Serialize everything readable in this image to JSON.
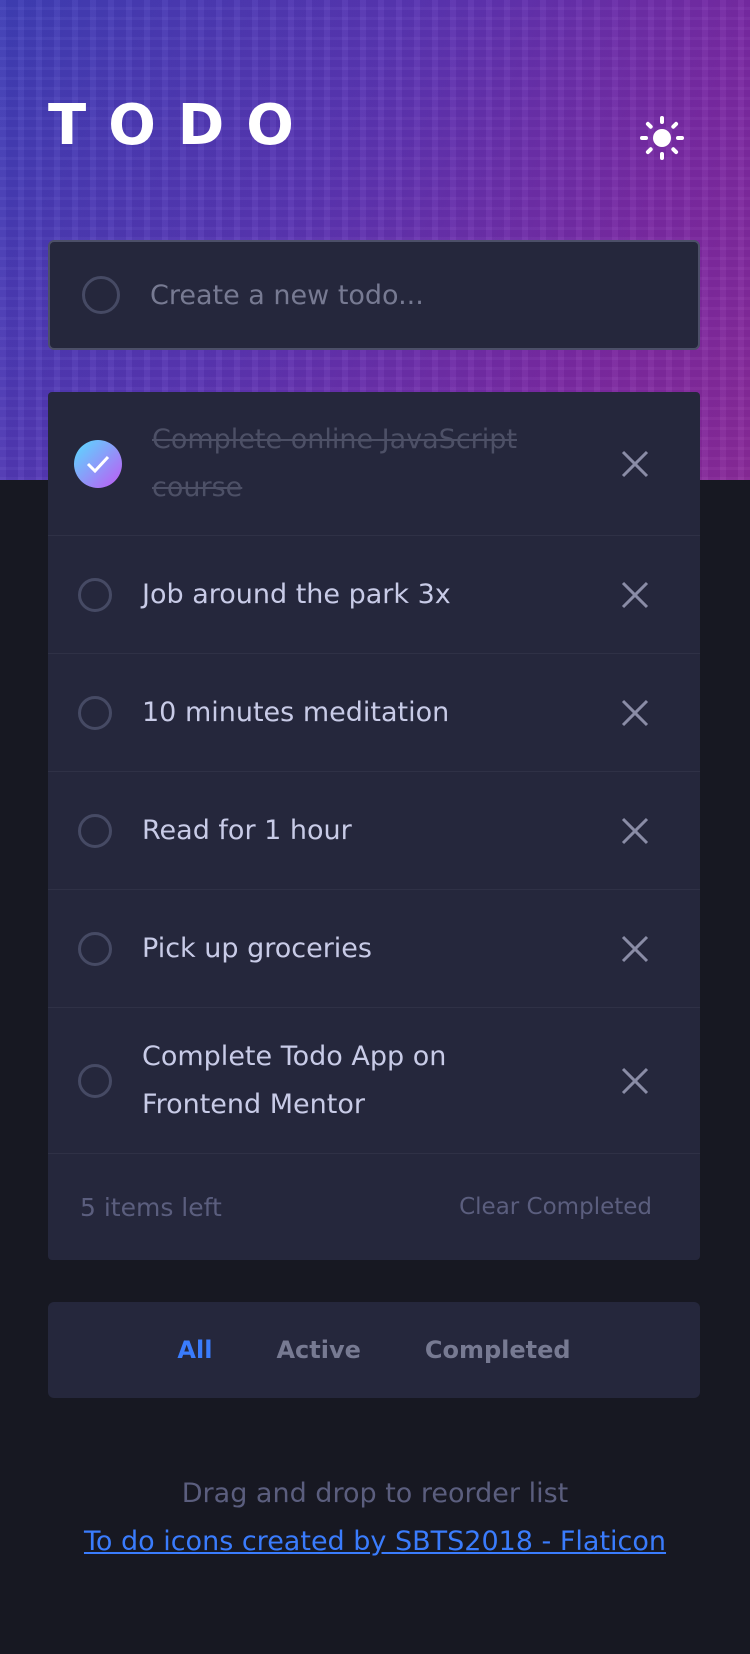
{
  "header": {
    "title": "TODO",
    "theme_toggle_icon": "sun-icon"
  },
  "new_todo": {
    "placeholder": "Create a new todo...",
    "value": ""
  },
  "todos": [
    {
      "text": "Complete online JavaScript course",
      "completed": true
    },
    {
      "text": "Job around the park 3x",
      "completed": false
    },
    {
      "text": "10 minutes meditation",
      "completed": false
    },
    {
      "text": "Read for 1 hour",
      "completed": false
    },
    {
      "text": "Pick up groceries",
      "completed": false
    },
    {
      "text": "Complete Todo App on Frontend Mentor",
      "completed": false
    }
  ],
  "list_footer": {
    "items_left": "5 items left",
    "clear_label": "Clear Completed"
  },
  "filters": {
    "all": "All",
    "active": "Active",
    "completed": "Completed",
    "selected": "All"
  },
  "hint": "Drag and drop to reorder list",
  "credit": "To do icons created by SBTS2018 - Flaticon",
  "colors": {
    "accent": "#3a7cfd",
    "background": "#171822",
    "card": "#25273c",
    "check_gradient_start": "#57ddff",
    "check_gradient_end": "#c058f3"
  }
}
